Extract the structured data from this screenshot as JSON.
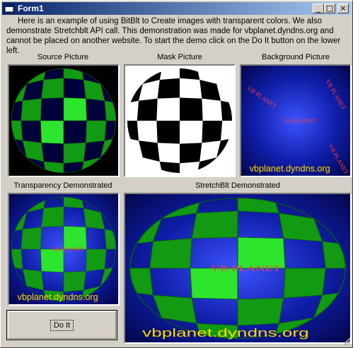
{
  "window": {
    "title": "Form1",
    "minimize_glyph": "_",
    "maximize_glyph": "□",
    "close_glyph": "×"
  },
  "description": "Here is an example of using BitBlt to Create images with transparent colors. We also demonstrate Stretchblt API call.  This demonstration was made for vbplanet.dyndns.org and cannot be placed on another website.  To start the demo click on the Do It button on the lower left.",
  "labels": {
    "source": "Source Picture",
    "mask": "Mask Picture",
    "background": "Background Picture",
    "transparency": "Transparency Demonstrated",
    "stretch": "StretchBlt Demonstrated"
  },
  "picture_text": {
    "url": "vbplanet.dyndns.org",
    "brand": "VB PLANET"
  },
  "button": {
    "doit_label": "Do It"
  },
  "colors": {
    "green_bright": "#2ee52e",
    "green_mid": "#139a13",
    "blue_dark": "#00003a",
    "blue_bright": "#1a2fd8",
    "red_text": "#ff3b3b",
    "yellow_text": "#ffd700"
  }
}
